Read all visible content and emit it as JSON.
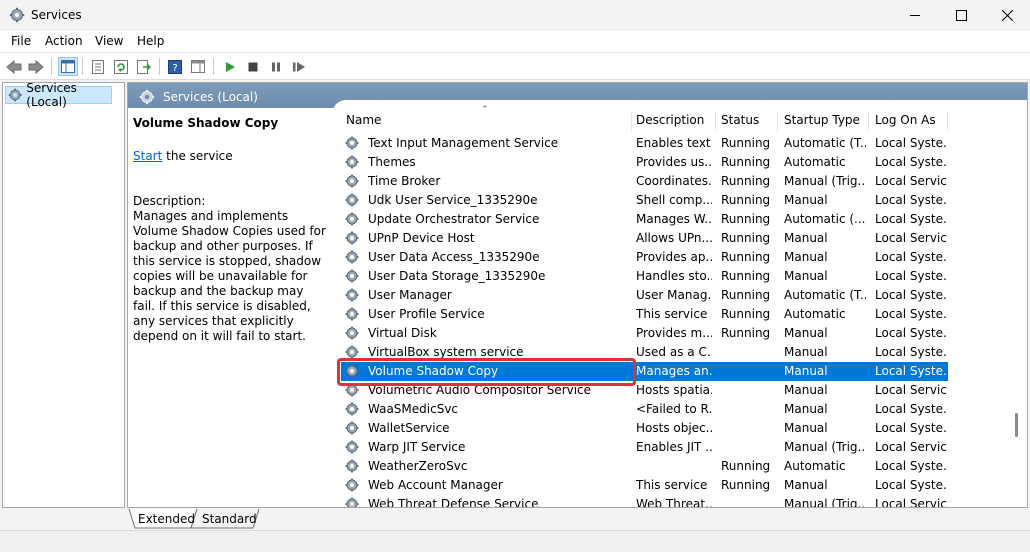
{
  "window": {
    "title": "Services"
  },
  "menu": [
    "File",
    "Action",
    "View",
    "Help"
  ],
  "tree": {
    "root_label": "Services (Local)"
  },
  "content": {
    "header_title": "Services (Local)"
  },
  "details": {
    "service_name": "Volume Shadow Copy",
    "start_link": "Start",
    "start_suffix": " the service",
    "description_label": "Description:",
    "description": "Manages and implements Volume Shadow Copies used for backup and other purposes. If this service is stopped, shadow copies will be unavailable for backup and the backup may fail. If this service is disabled, any services that explicitly depend on it will fail to start."
  },
  "columns": [
    "Name",
    "Description",
    "Status",
    "Startup Type",
    "Log On As"
  ],
  "rows": [
    {
      "name": "Text Input Management Service",
      "description": "Enables text...",
      "status": "Running",
      "startup": "Automatic (T...",
      "logon": "Local Syste..."
    },
    {
      "name": "Themes",
      "description": "Provides us...",
      "status": "Running",
      "startup": "Automatic",
      "logon": "Local Syste..."
    },
    {
      "name": "Time Broker",
      "description": "Coordinates...",
      "status": "Running",
      "startup": "Manual (Trig...",
      "logon": "Local Service"
    },
    {
      "name": "Udk User Service_1335290e",
      "description": "Shell comp...",
      "status": "Running",
      "startup": "Manual",
      "logon": "Local Syste..."
    },
    {
      "name": "Update Orchestrator Service",
      "description": "Manages W...",
      "status": "Running",
      "startup": "Automatic (...",
      "logon": "Local Syste..."
    },
    {
      "name": "UPnP Device Host",
      "description": "Allows UPn...",
      "status": "Running",
      "startup": "Manual",
      "logon": "Local Service"
    },
    {
      "name": "User Data Access_1335290e",
      "description": "Provides ap...",
      "status": "Running",
      "startup": "Manual",
      "logon": "Local Syste..."
    },
    {
      "name": "User Data Storage_1335290e",
      "description": "Handles sto...",
      "status": "Running",
      "startup": "Manual",
      "logon": "Local Syste..."
    },
    {
      "name": "User Manager",
      "description": "User Manag...",
      "status": "Running",
      "startup": "Automatic (T...",
      "logon": "Local Syste..."
    },
    {
      "name": "User Profile Service",
      "description": "This service ...",
      "status": "Running",
      "startup": "Automatic",
      "logon": "Local Syste..."
    },
    {
      "name": "Virtual Disk",
      "description": "Provides m...",
      "status": "Running",
      "startup": "Manual",
      "logon": "Local Syste..."
    },
    {
      "name": "VirtualBox system service",
      "description": "Used as a C...",
      "status": "",
      "startup": "Manual",
      "logon": "Local Syste..."
    },
    {
      "name": "Volume Shadow Copy",
      "description": "Manages an...",
      "status": "",
      "startup": "Manual",
      "logon": "Local Syste...",
      "selected": true
    },
    {
      "name": "Volumetric Audio Compositor Service",
      "description": "Hosts spatia...",
      "status": "",
      "startup": "Manual",
      "logon": "Local Service"
    },
    {
      "name": "WaaSMedicSvc",
      "description": "<Failed to R...",
      "status": "",
      "startup": "Manual",
      "logon": "Local Syste..."
    },
    {
      "name": "WalletService",
      "description": "Hosts objec...",
      "status": "",
      "startup": "Manual",
      "logon": "Local Syste..."
    },
    {
      "name": "Warp JIT Service",
      "description": "Enables JIT ...",
      "status": "",
      "startup": "Manual (Trig...",
      "logon": "Local Service"
    },
    {
      "name": "WeatherZeroSvc",
      "description": "",
      "status": "Running",
      "startup": "Automatic",
      "logon": "Local Syste..."
    },
    {
      "name": "Web Account Manager",
      "description": "This service ...",
      "status": "Running",
      "startup": "Manual",
      "logon": "Local Syste..."
    },
    {
      "name": "Web Threat Defense Service",
      "description": "Web Threat...",
      "status": "",
      "startup": "Manual (Trig...",
      "logon": "Local Service"
    }
  ],
  "tabs": [
    "Extended",
    "Standard"
  ],
  "colors": {
    "selection": "#0078d7",
    "highlight_box": "#e0303a",
    "header_band": "#7e9ab8"
  }
}
